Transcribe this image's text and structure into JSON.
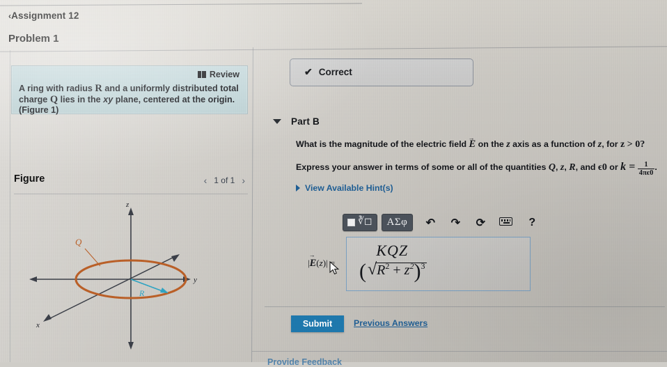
{
  "header": {
    "breadcrumb_chevron": "‹",
    "breadcrumb": "Assignment 12",
    "problem_title": "Problem 1"
  },
  "left": {
    "review_label": "Review",
    "review_icon": "book-icon",
    "problem_text_line1_a": "A ring with radius ",
    "problem_text_R": "R",
    "problem_text_line1_b": " and a uniformly distributed total charge",
    "problem_text_Q": "Q",
    "problem_text_line2_a": " lies in the ",
    "problem_text_xy": "xy",
    "problem_text_line2_b": " plane, centered at the origin. (Figure 1)",
    "figure_label": "Figure",
    "figure_prev_icon": "‹",
    "figure_counter": "1 of 1",
    "figure_next_icon": "›"
  },
  "figure": {
    "axis_z": "z",
    "axis_y": "y",
    "axis_x": "x",
    "charge_label": "Q",
    "radius_label": "R",
    "ring_color": "#bd6128",
    "radius_color": "#2fa6c6",
    "axis_color": "#3c4049"
  },
  "right": {
    "status_icon": "check-icon",
    "status_label": "Correct",
    "part_toggle_icon": "chevron-down-icon",
    "part_label": "Part B",
    "question_line1_a": "What is the magnitude of the electric field ",
    "question_line1_E": "E",
    "question_line1_b": " on the ",
    "question_line1_z1": "z",
    "question_line1_c": " axis as a function of ",
    "question_line1_z2": "z",
    "question_line1_d": ", for ",
    "question_line1_cond": "z > 0?",
    "question_line2_a": "Express your answer in terms of some or all of the quantities ",
    "question_line2_Q": "Q",
    "question_line2_sep1": ", ",
    "question_line2_z": "z",
    "question_line2_sep2": ", ",
    "question_line2_R": "R",
    "question_line2_b": ", and ",
    "question_line2_eps": "ϵ0",
    "question_line2_c": " or ",
    "question_line2_k": "k =",
    "frac_num": "1",
    "frac_den": "4πϵ0",
    "question_line2_period": ".",
    "hints_icon": "chevron-right-icon",
    "hints_label": "View Available Hint(s)",
    "toolbar": {
      "template_button": "□ⁿ√□",
      "greek_button": "ΑΣφ",
      "undo_icon": "↶",
      "redo_icon": "↷",
      "reset_icon": "⟳",
      "keyboard_icon": "keyboard-icon",
      "help_icon": "?"
    },
    "answer": {
      "label": "|E(z)| =",
      "numerator": "KQZ",
      "denominator_open": "(",
      "denominator_R": "R",
      "denominator_Rsup": "2",
      "denominator_plus": "+",
      "denominator_z": "z",
      "denominator_zsup": "2",
      "denominator_close": ")",
      "denominator_exp": "3"
    },
    "submit_label": "Submit",
    "previous_answers_label": "Previous Answers",
    "provide_feedback_label": "Provide Feedback",
    "accent_color": "#1f7ab0",
    "link_color": "#1f5f96"
  }
}
